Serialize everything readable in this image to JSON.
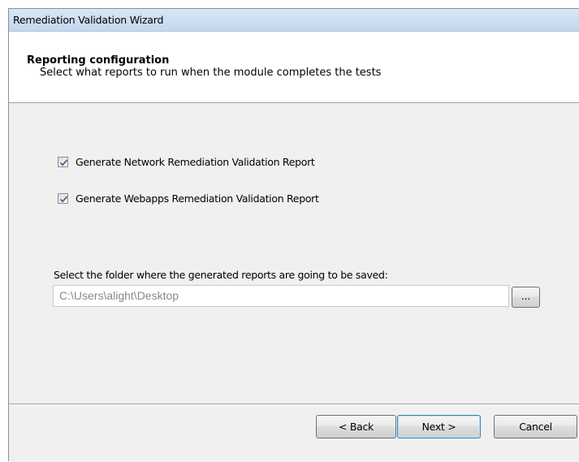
{
  "window": {
    "title": "Remediation Validation Wizard"
  },
  "header": {
    "heading": "Reporting configuration",
    "subheading": "Select what reports to run when the module completes the tests"
  },
  "options": [
    {
      "label": "Generate Network Remediation Validation Report",
      "checked": true
    },
    {
      "label": "Generate Webapps Remediation Validation Report",
      "checked": true
    }
  ],
  "folder": {
    "label": "Select the folder where the generated reports are going to be saved:",
    "value": "C:\\Users\\alight\\Desktop",
    "browse_label": "..."
  },
  "footer": {
    "back_label": "< Back",
    "next_label": "Next >",
    "cancel_label": "Cancel"
  }
}
